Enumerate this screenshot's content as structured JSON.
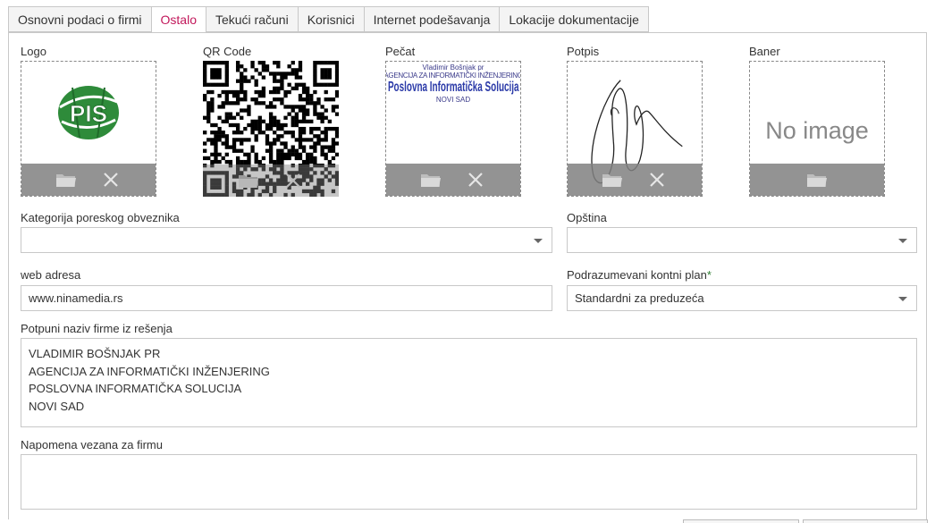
{
  "tabs": [
    {
      "label": "Osnovni podaci o firmi",
      "active": false
    },
    {
      "label": "Ostalo",
      "active": true
    },
    {
      "label": "Tekući računi",
      "active": false
    },
    {
      "label": "Korisnici",
      "active": false
    },
    {
      "label": "Internet podešavanja",
      "active": false
    },
    {
      "label": "Lokacije dokumentacije",
      "active": false
    }
  ],
  "images": {
    "logo": {
      "label": "Logo",
      "logo_text": "PIS"
    },
    "qr": {
      "label": "QR Code"
    },
    "stamp": {
      "label": "Pečat",
      "line1": "Vladimir Bošnjak pr",
      "line2": "AGENCIJA ZA INFORMATIČKI INŽENJERING",
      "line3": "Poslovna Informatička Solucija",
      "line4": "NOVI SAD"
    },
    "signature": {
      "label": "Potpis"
    },
    "banner": {
      "label": "Baner",
      "placeholder": "No image"
    }
  },
  "icons": {
    "browse": "folder-icon",
    "remove": "close-icon"
  },
  "fields": {
    "tax_category": {
      "label": "Kategorija poreskog obveznika",
      "value": ""
    },
    "municipality": {
      "label": "Opština",
      "value": ""
    },
    "web": {
      "label": "web adresa",
      "value": "www.ninamedia.rs"
    },
    "chart_of_accounts": {
      "label": "Podrazumevani kontni plan",
      "required_mark": "*",
      "value": "Standardni za preduzeća"
    },
    "full_name": {
      "label": "Potpuni naziv firme iz rešenja",
      "lines": [
        "VLADIMIR BOŠNJAK PR",
        "AGENCIJA ZA INFORMATIČKI INŽENJERING",
        "POSLOVNA INFORMATIČKA SOLUCIJA",
        "NOVI SAD"
      ]
    },
    "note": {
      "label": "Napomena vezana za firmu",
      "value": ""
    }
  },
  "colors": {
    "active_tab": "#c2185b",
    "required": "#2e7d32",
    "logo_green": "#2e8b3a"
  }
}
